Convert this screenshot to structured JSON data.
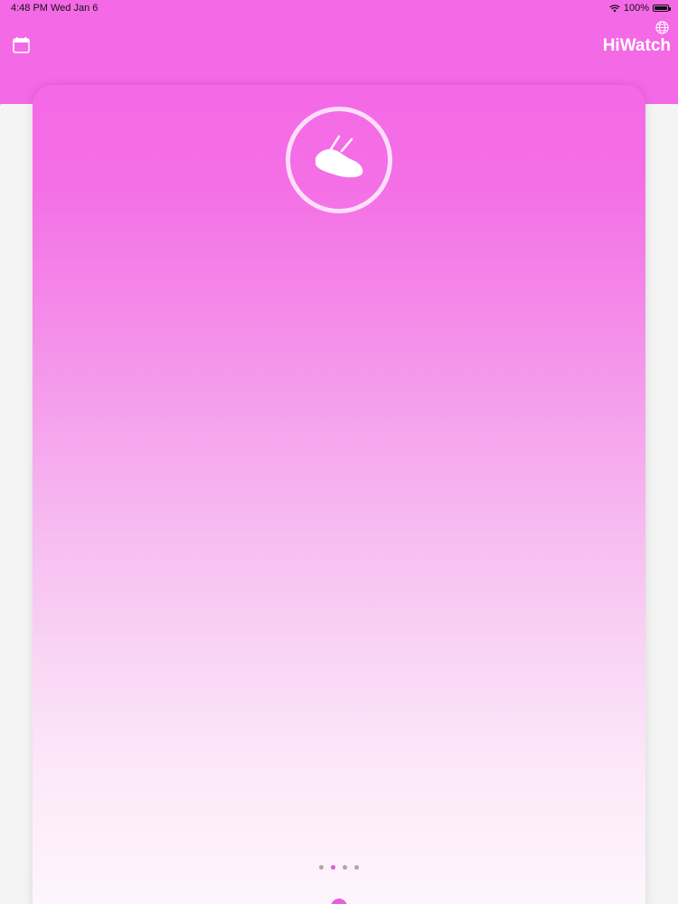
{
  "status_bar": {
    "time": "4:48 PM",
    "date": "Wed Jan 6",
    "battery": "100%",
    "battery_level": 1.0
  },
  "header": {
    "title": "HiWatch",
    "left_icon": "calendar-icon",
    "right_icon": "globe-icon"
  },
  "card": {
    "activity_icon": "sock-icon",
    "page_count": 4,
    "active_page_index": 1
  },
  "colors": {
    "accent": "#f469e6",
    "active_dot": "#e455d8",
    "inactive_dot": "#a9a9a9"
  }
}
